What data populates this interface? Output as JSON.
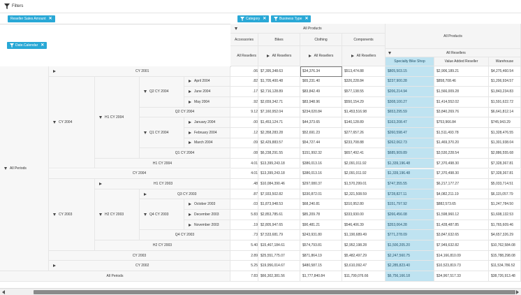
{
  "filters": {
    "label": "Filters",
    "icon": "filter-icon"
  },
  "chips": {
    "value_field": "Reseller Sales Amount",
    "row_field": "Date.Calendar",
    "column_fields": [
      "Category",
      "Business Type"
    ]
  },
  "columns": {
    "all_products": "All Products",
    "categories": [
      "Accessories",
      "Bikes",
      "Clothing",
      "Components"
    ],
    "all_resellers": "All Resellers",
    "right_all_products": "All Products",
    "right_all_resellers": "All Resellers",
    "business_types": [
      "Specialty Bike Shop",
      "Value Added Reseller",
      "Warehouse"
    ]
  },
  "rows": {
    "all_periods": "All Periods",
    "cy2004": "CY 2004",
    "cy2003": "CY 2003",
    "h1cy2004": "H1 CY 2004",
    "h2cy2003": "H2 CY 2003",
    "labels": [
      "CY 2001",
      "April 2004",
      "June 2004",
      "May 2004",
      "Q2 CY 2004",
      "January 2004",
      "February 2004",
      "March 2004",
      "Q1 CY 2004",
      "H1 CY 2004",
      "CY 2004",
      "H1 CY 2003",
      "Q3 CY 2003",
      "October 2003",
      "December 2003",
      "November 2003",
      "Q4 CY 2003",
      "H2 CY 2003",
      "CY 2003",
      "CY 2002",
      "All Periods"
    ],
    "q2cy2004": "Q2 CY 2004",
    "q1cy2004": "Q1 CY 2004",
    "q4cy2003": "Q4 CY 2003"
  },
  "values": [
    [
      "$7,395,348.63",
      "$34,376.34",
      "$513,474.88",
      "$805,503.15",
      "$2,906,189.21",
      "$4,275,460.54"
    ],
    [
      "$1,705,400.48",
      "$65,231.40",
      "$326,228.84",
      "$237,900.28",
      "$858,708.46",
      "$1,206,934.57"
    ],
    [
      "$2,716,128.89",
      "$83,842.49",
      "$577,138.55",
      "$206,214.94",
      "$1,566,009.28",
      "$1,843,234.83"
    ],
    [
      "$2,659,342.71",
      "$83,948.96",
      "$550,154.29",
      "$308,100.27",
      "$1,414,552.02",
      "$1,591,622.72"
    ],
    [
      "$7,160,952.04",
      "$234,020.84",
      "$1,453,516.98",
      "$653,295.59",
      "$3,840,269.76",
      "$6,641,812.14"
    ],
    [
      "$1,453,124.71",
      "$44,373.65",
      "$140,128.89",
      "$163,208.47",
      "$753,966.84",
      "$745,943.29"
    ],
    [
      "$2,358,283.28",
      "$52,691.23",
      "$277,657.26",
      "$260,598.47",
      "$1,511,493.78",
      "$1,328,476.55"
    ],
    [
      "$2,429,883.57",
      "$54,727.44",
      "$233,708.88",
      "$262,062.73",
      "$1,469,370.20",
      "$1,301,938.04"
    ],
    [
      "$6,238,291.55",
      "$151,992.32",
      "$657,492.41",
      "$685,909.89",
      "$3,530,228.54",
      "$2,886,555.68"
    ],
    [
      "$13,399,243.18",
      "$386,013.16",
      "$2,091,011.92",
      "$1,339,196.48",
      "$7,370,498.30",
      "$7,328,367.81"
    ],
    [
      "$13,399,243.18",
      "$386,013.16",
      "$2,091,011.92",
      "$1,339,196.48",
      "$7,370,498.30",
      "$7,328,367.81"
    ],
    [
      "$10,084,390.46",
      "$297,080.37",
      "$1,570,299.01",
      "$747,355.55",
      "$6,217,177.27",
      "$5,033,714.51"
    ],
    [
      "$7,933,502.82",
      "$330,872.01",
      "$2,321,508.59",
      "$728,827.11",
      "$4,082,211.19",
      "$6,115,057.79"
    ],
    [
      "$1,873,948.53",
      "$68,240.81",
      "$310,952.80",
      "$151,797.92",
      "$882,573.65",
      "$1,247,784.50"
    ],
    [
      "$2,853,785.61",
      "$85,209.78",
      "$333,930.00",
      "$266,456.08",
      "$1,598,960.12",
      "$1,608,132.53"
    ],
    [
      "$2,805,947.65",
      "$90,481.21",
      "$546,406.39",
      "$353,064.28",
      "$1,428,487.85",
      "$1,765,609.46"
    ],
    [
      "$7,533,681.79",
      "$243,931.80",
      "$1,190,689.49",
      "$771,278.09",
      "$3,847,632.65",
      "$4,657,326.29"
    ],
    [
      "$15,467,184.61",
      "$574,793.81",
      "$2,952,198.28",
      "$1,500,205.20",
      "$7,949,632.82",
      "$10,762,584.08"
    ],
    [
      "$25,551,775.07",
      "$871,864.19",
      "$5,482,497.29",
      "$2,247,560.75",
      "$14,166,810.09",
      "$15,788,298.08"
    ],
    [
      "$19,956,014.67",
      "$480,587.15",
      "$3,610,092.47",
      "$2,285,823.40",
      "$10,523,819.73",
      "$11,534,786.52"
    ],
    [
      "$66,302,381.56",
      "$1,777,840.84",
      "$11,799,076.66",
      "$6,756,166.18",
      "$34,967,517.33",
      "$38,726,913.48"
    ]
  ],
  "row_prefix": [
    ".06",
    ".82",
    ".17",
    ".92",
    "9.12",
    ".00",
    ".12",
    ".09",
    ".08",
    "4.01",
    "4.01",
    ".48",
    ".87",
    ".03",
    "5.83",
    ".19",
    ".73",
    "5.40",
    "2.89",
    "5.25",
    "7.83"
  ]
}
